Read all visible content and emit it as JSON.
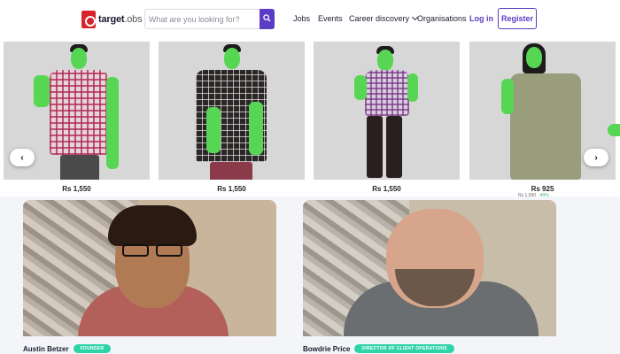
{
  "header": {
    "logo_main": "target",
    "logo_sub": ".obs",
    "search_placeholder": "What are you looking for?",
    "nav": [
      "Jobs",
      "Events",
      "Career discovery",
      "Organisations"
    ],
    "login_label": "Log in",
    "register_label": "Register"
  },
  "products": [
    {
      "price": "Rs 1,550",
      "shirt": "red plaid"
    },
    {
      "price": "Rs 1,550",
      "shirt": "dark plaid"
    },
    {
      "price": "Rs 1,550",
      "shirt": "purple plaid"
    },
    {
      "price": "Rs 925",
      "shirt": "olive"
    }
  ],
  "carousel": {
    "prev_glyph": "‹",
    "next_glyph": "›"
  },
  "partial_price": {
    "original": "Rs 1,550",
    "discount": "-40%"
  },
  "team": [
    {
      "name": "Austin Betzer",
      "role": "FOUNDER"
    },
    {
      "name": "Bowdrie Price",
      "role": "DIRECTOR OF CLIENT OPERATIONS"
    }
  ],
  "colors": {
    "brand": "#5b3cc4",
    "logo_red": "#d8232a",
    "badge": "#2ed3a8",
    "chroma": "#57d653"
  },
  "icons": {
    "search": "search-icon",
    "chevron": "chevron-down-icon",
    "prev": "chevron-left-icon",
    "next": "chevron-right-icon"
  }
}
